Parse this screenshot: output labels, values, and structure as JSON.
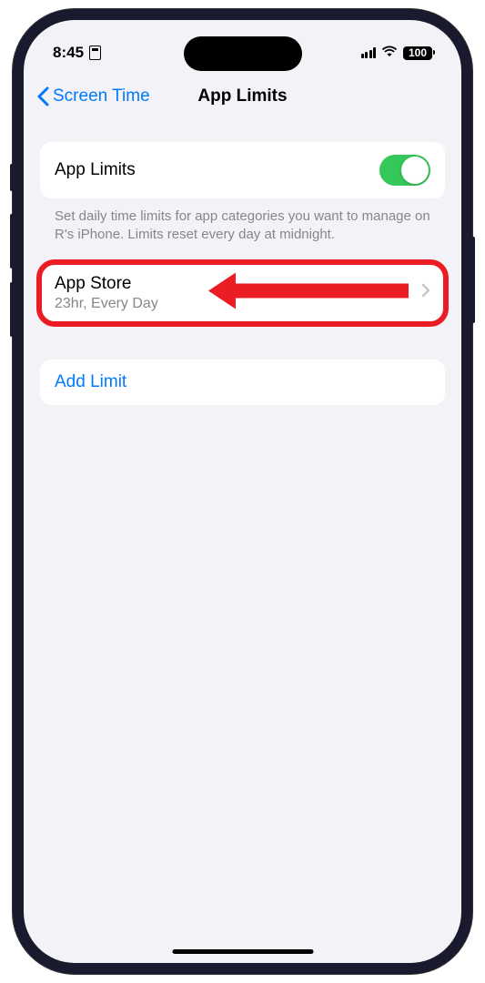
{
  "status": {
    "time": "8:45",
    "battery": "100"
  },
  "nav": {
    "back_label": "Screen Time",
    "title": "App Limits"
  },
  "toggle_section": {
    "label": "App Limits",
    "description": "Set daily time limits for app categories you want to manage on R's iPhone. Limits reset every day at midnight."
  },
  "limit": {
    "title": "App Store",
    "subtitle": "23hr, Every Day"
  },
  "add_limit": {
    "label": "Add Limit"
  }
}
